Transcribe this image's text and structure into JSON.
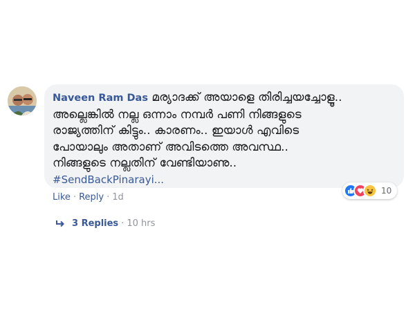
{
  "comment": {
    "author": "Naveen Ram Das",
    "text": "മര്യാദക്ക് അയാളെ തിരിച്ചയച്ചോളൂ..\nഅല്ലെങ്കിൽ നല്ല ഒന്നാം നമ്പർ പണി നിങ്ങളുടെ\nരാജ്യത്തിന് കിട്ടും.. കാരണം.. ഇയാൾ എവിടെ\nപോയാലും അതാണ് അവിടത്തെ അവസ്ഥ..\nനിങ്ങളുടെ നല്ലതിന് വേണ്ടിയാണു..",
    "hashtag": "#SendBackPinarayi...",
    "reactions": {
      "icons": [
        "like-icon",
        "love-icon",
        "haha-icon"
      ],
      "count": "10",
      "colors": {
        "like": "#2078f4",
        "love": "#f0435e",
        "haha": "#f7c340"
      }
    },
    "actions": {
      "like_label": "Like",
      "reply_label": "Reply",
      "separator": "·",
      "timestamp": "1d"
    },
    "replies": {
      "label": "3 Replies",
      "separator": "·",
      "timestamp": "10 hrs",
      "icon": "reply-arrow-icon"
    }
  },
  "colors": {
    "link": "#385898",
    "bubble": "#f2f3f5",
    "muted": "#90949c"
  }
}
